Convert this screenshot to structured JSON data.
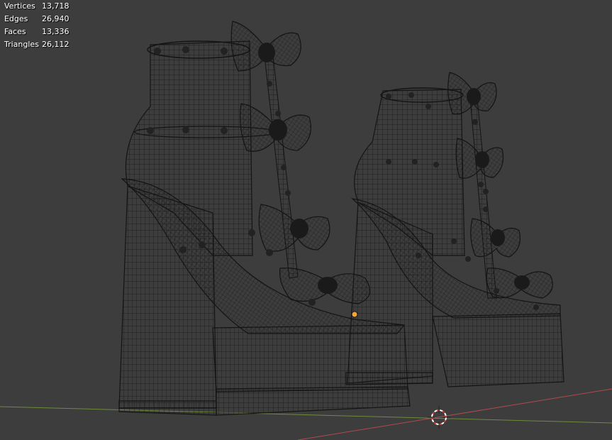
{
  "viewport": {
    "background": "#3d3d3d",
    "wire_color": "#141414",
    "x_axis_color": "#b04a4f",
    "y_axis_color": "#6f8a3e",
    "origin_color": "#f4a53b"
  },
  "stats": [
    {
      "label": "Vertices",
      "value": "13,718"
    },
    {
      "label": "Edges",
      "value": "26,940"
    },
    {
      "label": "Faces",
      "value": "13,336"
    },
    {
      "label": "Triangles",
      "value": "26,112"
    }
  ],
  "icons": {
    "cursor": "3d-cursor-icon",
    "origin": "object-origin-icon"
  }
}
